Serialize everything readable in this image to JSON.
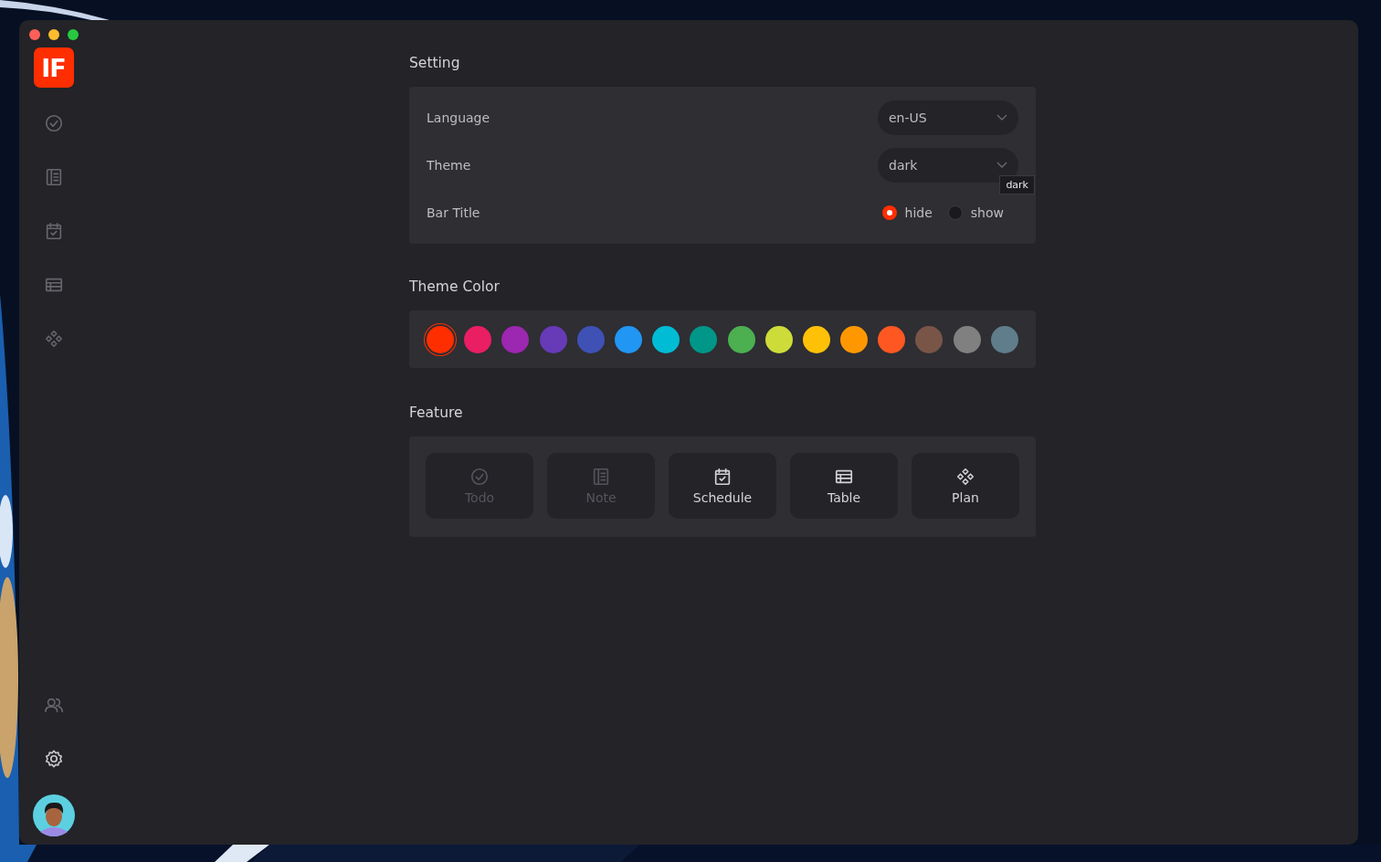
{
  "logo": {
    "text": "IF"
  },
  "sidebar": {
    "items": [
      {
        "kind": "todo",
        "selected": false
      },
      {
        "kind": "note",
        "selected": false
      },
      {
        "kind": "schedule",
        "selected": false
      },
      {
        "kind": "table",
        "selected": false
      },
      {
        "kind": "plan",
        "selected": false
      }
    ],
    "bottom_items": [
      {
        "kind": "users",
        "selected": false
      },
      {
        "kind": "settings",
        "selected": true
      }
    ]
  },
  "setting": {
    "title": "Setting",
    "rows": [
      {
        "kind": "select",
        "label": "Language",
        "value": "en-US"
      },
      {
        "kind": "select",
        "label": "Theme",
        "value": "dark",
        "tooltip": "dark"
      },
      {
        "kind": "radio",
        "label": "Bar Title",
        "options": [
          {
            "label": "hide",
            "selected": true
          },
          {
            "label": "show",
            "selected": false
          }
        ]
      }
    ]
  },
  "theme_color": {
    "title": "Theme Color",
    "colors": [
      {
        "color": "#ff2e00",
        "selected": true
      },
      {
        "color": "#e91e63",
        "selected": false
      },
      {
        "color": "#9c27b0",
        "selected": false
      },
      {
        "color": "#673ab7",
        "selected": false
      },
      {
        "color": "#3f51b5",
        "selected": false
      },
      {
        "color": "#2196f3",
        "selected": false
      },
      {
        "color": "#00bcd4",
        "selected": false
      },
      {
        "color": "#009688",
        "selected": false
      },
      {
        "color": "#4caf50",
        "selected": false
      },
      {
        "color": "#cddc39",
        "selected": false
      },
      {
        "color": "#ffc107",
        "selected": false
      },
      {
        "color": "#ff9800",
        "selected": false
      },
      {
        "color": "#ff5722",
        "selected": false
      },
      {
        "color": "#795548",
        "selected": false
      },
      {
        "color": "#808080",
        "selected": false
      },
      {
        "color": "#607d8b",
        "selected": false
      }
    ]
  },
  "feature": {
    "title": "Feature",
    "items": [
      {
        "kind": "todo",
        "label": "Todo",
        "enabled": false
      },
      {
        "kind": "note",
        "label": "Note",
        "enabled": false
      },
      {
        "kind": "schedule",
        "label": "Schedule",
        "enabled": true
      },
      {
        "kind": "table",
        "label": "Table",
        "enabled": true
      },
      {
        "kind": "plan",
        "label": "Plan",
        "enabled": true
      }
    ]
  }
}
